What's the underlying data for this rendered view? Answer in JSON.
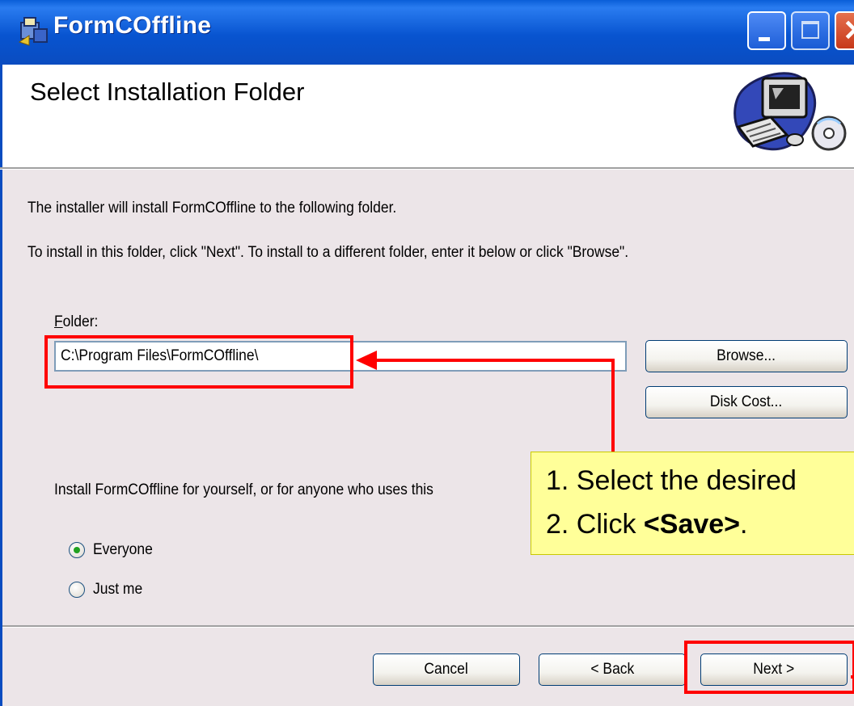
{
  "window": {
    "title": "FormCOffline",
    "app_icon": "installer-icon"
  },
  "banner": {
    "title": "Select Installation Folder",
    "art": "computer-cd-icon"
  },
  "body": {
    "intro": "The installer will install FormCOffline to the following folder.",
    "instructions": "To install in this folder, click \"Next\". To install to a different folder, enter it below or click \"Browse\".",
    "folder_label_accel": "F",
    "folder_label_rest": "older:",
    "folder_value": "C:\\Program Files\\FormCOffline\\",
    "browse_label": "Browse...",
    "disk_cost_label": "Disk Cost...",
    "install_for_text": "Install FormCOffline for yourself, or for anyone who uses this",
    "options": [
      {
        "label": "Everyone",
        "selected": true
      },
      {
        "label": "Just me",
        "selected": false
      }
    ]
  },
  "footer": {
    "cancel_label": "Cancel",
    "back_label": "< Back",
    "next_label": "Next >"
  },
  "annotation": {
    "line1": "1. Select the desired",
    "line2_prefix": "2. Click ",
    "line2_bold": "<Save>",
    "line2_suffix": ".",
    "highlight_color": "#ff0000",
    "callout_color": "#ffff99"
  }
}
